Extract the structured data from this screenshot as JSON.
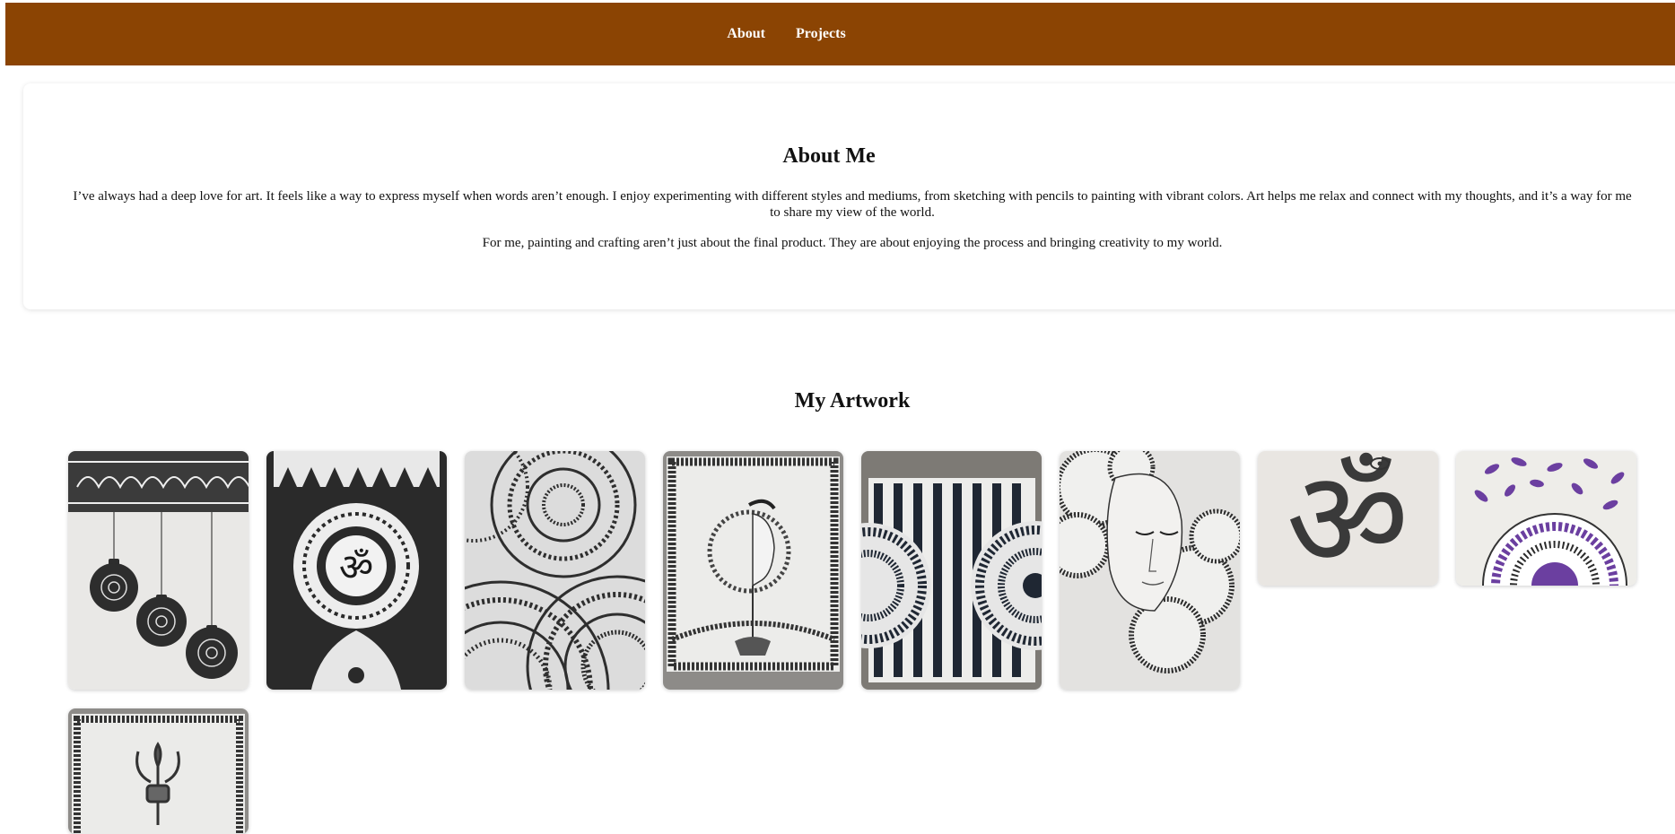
{
  "nav": {
    "about": "About",
    "projects": "Projects"
  },
  "about": {
    "title": "About Me",
    "paragraph1": "I’ve always had a deep love for art. It feels like a way to express myself when words aren’t enough. I enjoy experimenting with different styles and mediums, from sketching with pencils to painting with vibrant colors. Art helps me relax and connect with my thoughts, and it’s a way for me to share my view of the world.",
    "paragraph2": "For me, painting and crafting aren’t just about the final product. They are about enjoying the process and bringing creativity to my world."
  },
  "artwork": {
    "title": "My Artwork"
  },
  "colors": {
    "navbar": "#8b4403",
    "text": "#111111",
    "background": "#ffffff",
    "accent_purple": "#6b3fa0"
  }
}
